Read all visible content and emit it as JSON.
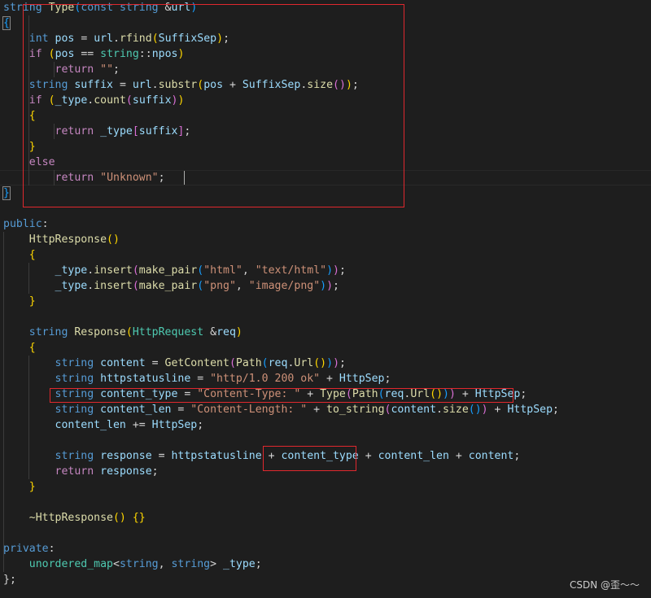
{
  "editor": {
    "lines": [
      [
        [
          "k",
          "string"
        ],
        [
          "p",
          " "
        ],
        [
          "f",
          "Type"
        ],
        [
          "b3",
          "("
        ],
        [
          "k",
          "const"
        ],
        [
          "p",
          " "
        ],
        [
          "k",
          "string"
        ],
        [
          "p",
          " &"
        ],
        [
          "prm",
          "url"
        ],
        [
          "b3",
          ")"
        ]
      ],
      [
        [
          "b3",
          "{"
        ]
      ],
      [
        [
          "p",
          "    "
        ],
        [
          "k",
          "int"
        ],
        [
          "p",
          " "
        ],
        [
          "v",
          "pos"
        ],
        [
          "p",
          " = "
        ],
        [
          "v",
          "url"
        ],
        [
          "p",
          "."
        ],
        [
          "f",
          "rfind"
        ],
        [
          "b1",
          "("
        ],
        [
          "v",
          "SuffixSep"
        ],
        [
          "b1",
          ")"
        ],
        [
          "p",
          ";"
        ]
      ],
      [
        [
          "p",
          "    "
        ],
        [
          "c",
          "if"
        ],
        [
          "p",
          " "
        ],
        [
          "b1",
          "("
        ],
        [
          "v",
          "pos"
        ],
        [
          "p",
          " == "
        ],
        [
          "t",
          "string"
        ],
        [
          "p",
          "::"
        ],
        [
          "v",
          "npos"
        ],
        [
          "b1",
          ")"
        ]
      ],
      [
        [
          "p",
          "        "
        ],
        [
          "c",
          "return"
        ],
        [
          "p",
          " "
        ],
        [
          "s",
          "\"\""
        ],
        [
          "p",
          ";"
        ]
      ],
      [
        [
          "p",
          "    "
        ],
        [
          "k",
          "string"
        ],
        [
          "p",
          " "
        ],
        [
          "v",
          "suffix"
        ],
        [
          "p",
          " = "
        ],
        [
          "v",
          "url"
        ],
        [
          "p",
          "."
        ],
        [
          "f",
          "substr"
        ],
        [
          "b1",
          "("
        ],
        [
          "v",
          "pos"
        ],
        [
          "p",
          " + "
        ],
        [
          "v",
          "SuffixSep"
        ],
        [
          "p",
          "."
        ],
        [
          "f",
          "size"
        ],
        [
          "b2",
          "()"
        ],
        [
          "b1",
          ")"
        ],
        [
          "p",
          ";"
        ]
      ],
      [
        [
          "p",
          "    "
        ],
        [
          "c",
          "if"
        ],
        [
          "p",
          " "
        ],
        [
          "b1",
          "("
        ],
        [
          "v",
          "_type"
        ],
        [
          "p",
          "."
        ],
        [
          "f",
          "count"
        ],
        [
          "b2",
          "("
        ],
        [
          "v",
          "suffix"
        ],
        [
          "b2",
          ")"
        ],
        [
          "b1",
          ")"
        ]
      ],
      [
        [
          "p",
          "    "
        ],
        [
          "b1",
          "{"
        ]
      ],
      [
        [
          "p",
          "        "
        ],
        [
          "c",
          "return"
        ],
        [
          "p",
          " "
        ],
        [
          "v",
          "_type"
        ],
        [
          "b2",
          "["
        ],
        [
          "v",
          "suffix"
        ],
        [
          "b2",
          "]"
        ],
        [
          "p",
          ";"
        ]
      ],
      [
        [
          "p",
          "    "
        ],
        [
          "b1",
          "}"
        ]
      ],
      [
        [
          "p",
          "    "
        ],
        [
          "c",
          "else"
        ]
      ],
      [
        [
          "p",
          "        "
        ],
        [
          "c",
          "return"
        ],
        [
          "p",
          " "
        ],
        [
          "s",
          "\"Unknown\""
        ],
        [
          "p",
          ";"
        ]
      ],
      [
        [
          "b3",
          "}"
        ]
      ],
      [],
      [
        [
          "k",
          "public"
        ],
        [
          "p",
          ":"
        ]
      ],
      [
        [
          "p",
          "    "
        ],
        [
          "f",
          "HttpResponse"
        ],
        [
          "b1",
          "()"
        ]
      ],
      [
        [
          "p",
          "    "
        ],
        [
          "b1",
          "{"
        ]
      ],
      [
        [
          "p",
          "        "
        ],
        [
          "v",
          "_type"
        ],
        [
          "p",
          "."
        ],
        [
          "f",
          "insert"
        ],
        [
          "b2",
          "("
        ],
        [
          "f",
          "make_pair"
        ],
        [
          "b3",
          "("
        ],
        [
          "s",
          "\"html\""
        ],
        [
          "p",
          ", "
        ],
        [
          "s",
          "\"text/html\""
        ],
        [
          "b3",
          ")"
        ],
        [
          "b2",
          ")"
        ],
        [
          "p",
          ";"
        ]
      ],
      [
        [
          "p",
          "        "
        ],
        [
          "v",
          "_type"
        ],
        [
          "p",
          "."
        ],
        [
          "f",
          "insert"
        ],
        [
          "b2",
          "("
        ],
        [
          "f",
          "make_pair"
        ],
        [
          "b3",
          "("
        ],
        [
          "s",
          "\"png\""
        ],
        [
          "p",
          ", "
        ],
        [
          "s",
          "\"image/png\""
        ],
        [
          "b3",
          ")"
        ],
        [
          "b2",
          ")"
        ],
        [
          "p",
          ";"
        ]
      ],
      [
        [
          "p",
          "    "
        ],
        [
          "b1",
          "}"
        ]
      ],
      [],
      [
        [
          "p",
          "    "
        ],
        [
          "k",
          "string"
        ],
        [
          "p",
          " "
        ],
        [
          "f",
          "Response"
        ],
        [
          "b1",
          "("
        ],
        [
          "t",
          "HttpRequest"
        ],
        [
          "p",
          " &"
        ],
        [
          "prm",
          "req"
        ],
        [
          "b1",
          ")"
        ]
      ],
      [
        [
          "p",
          "    "
        ],
        [
          "b1",
          "{"
        ]
      ],
      [
        [
          "p",
          "        "
        ],
        [
          "k",
          "string"
        ],
        [
          "p",
          " "
        ],
        [
          "v",
          "content"
        ],
        [
          "p",
          " = "
        ],
        [
          "f",
          "GetContent"
        ],
        [
          "b2",
          "("
        ],
        [
          "f",
          "Path"
        ],
        [
          "b3",
          "("
        ],
        [
          "prm",
          "req"
        ],
        [
          "p",
          "."
        ],
        [
          "f",
          "Url"
        ],
        [
          "b1",
          "()"
        ],
        [
          "b3",
          ")"
        ],
        [
          "b2",
          ")"
        ],
        [
          "p",
          ";"
        ]
      ],
      [
        [
          "p",
          "        "
        ],
        [
          "k",
          "string"
        ],
        [
          "p",
          " "
        ],
        [
          "v",
          "httpstatusline"
        ],
        [
          "p",
          " = "
        ],
        [
          "s",
          "\"http/1.0 200 ok\""
        ],
        [
          "p",
          " + "
        ],
        [
          "v",
          "HttpSep"
        ],
        [
          "p",
          ";"
        ]
      ],
      [
        [
          "p",
          "        "
        ],
        [
          "k",
          "string"
        ],
        [
          "p",
          " "
        ],
        [
          "v",
          "content_type"
        ],
        [
          "p",
          " = "
        ],
        [
          "s",
          "\"Content-Type: \""
        ],
        [
          "p",
          " + "
        ],
        [
          "f",
          "Type"
        ],
        [
          "b2",
          "("
        ],
        [
          "f",
          "Path"
        ],
        [
          "b3",
          "("
        ],
        [
          "prm",
          "req"
        ],
        [
          "p",
          "."
        ],
        [
          "f",
          "Url"
        ],
        [
          "b1",
          "()"
        ],
        [
          "b3",
          ")"
        ],
        [
          "b2",
          ")"
        ],
        [
          "p",
          " + "
        ],
        [
          "v",
          "HttpSep"
        ],
        [
          "p",
          ";"
        ]
      ],
      [
        [
          "p",
          "        "
        ],
        [
          "k",
          "string"
        ],
        [
          "p",
          " "
        ],
        [
          "v",
          "content_len"
        ],
        [
          "p",
          " = "
        ],
        [
          "s",
          "\"Content-Length: \""
        ],
        [
          "p",
          " + "
        ],
        [
          "f",
          "to_string"
        ],
        [
          "b2",
          "("
        ],
        [
          "v",
          "content"
        ],
        [
          "p",
          "."
        ],
        [
          "f",
          "size"
        ],
        [
          "b3",
          "()"
        ],
        [
          "b2",
          ")"
        ],
        [
          "p",
          " + "
        ],
        [
          "v",
          "HttpSep"
        ],
        [
          "p",
          ";"
        ]
      ],
      [
        [
          "p",
          "        "
        ],
        [
          "v",
          "content_len"
        ],
        [
          "p",
          " += "
        ],
        [
          "v",
          "HttpSep"
        ],
        [
          "p",
          ";"
        ]
      ],
      [],
      [
        [
          "p",
          "        "
        ],
        [
          "k",
          "string"
        ],
        [
          "p",
          " "
        ],
        [
          "v",
          "response"
        ],
        [
          "p",
          " = "
        ],
        [
          "v",
          "httpstatusline"
        ],
        [
          "p",
          " + "
        ],
        [
          "v",
          "content_type"
        ],
        [
          "p",
          " + "
        ],
        [
          "v",
          "content_len"
        ],
        [
          "p",
          " + "
        ],
        [
          "v",
          "content"
        ],
        [
          "p",
          ";"
        ]
      ],
      [
        [
          "p",
          "        "
        ],
        [
          "c",
          "return"
        ],
        [
          "p",
          " "
        ],
        [
          "v",
          "response"
        ],
        [
          "p",
          ";"
        ]
      ],
      [
        [
          "p",
          "    "
        ],
        [
          "b1",
          "}"
        ]
      ],
      [],
      [
        [
          "p",
          "    "
        ],
        [
          "f",
          "~HttpResponse"
        ],
        [
          "b1",
          "()"
        ],
        [
          "p",
          " "
        ],
        [
          "b1",
          "{}"
        ]
      ],
      [],
      [
        [
          "k",
          "private"
        ],
        [
          "p",
          ":"
        ]
      ],
      [
        [
          "p",
          "    "
        ],
        [
          "t",
          "unordered_map"
        ],
        [
          "p",
          "<"
        ],
        [
          "k",
          "string"
        ],
        [
          "p",
          ", "
        ],
        [
          "k",
          "string"
        ],
        [
          "p",
          "> "
        ],
        [
          "v",
          "_type"
        ],
        [
          "p",
          ";"
        ]
      ],
      [
        [
          "p",
          "};"
        ]
      ]
    ]
  },
  "watermark": "CSDN @歪～～",
  "colors": {
    "background": "#1e1e1e",
    "keyword": "#569cd6",
    "control": "#c586c0",
    "type": "#4ec9b0",
    "function": "#dcdcaa",
    "variable": "#9cdcfe",
    "string": "#ce9178",
    "annotation_box": "#e0282e"
  }
}
